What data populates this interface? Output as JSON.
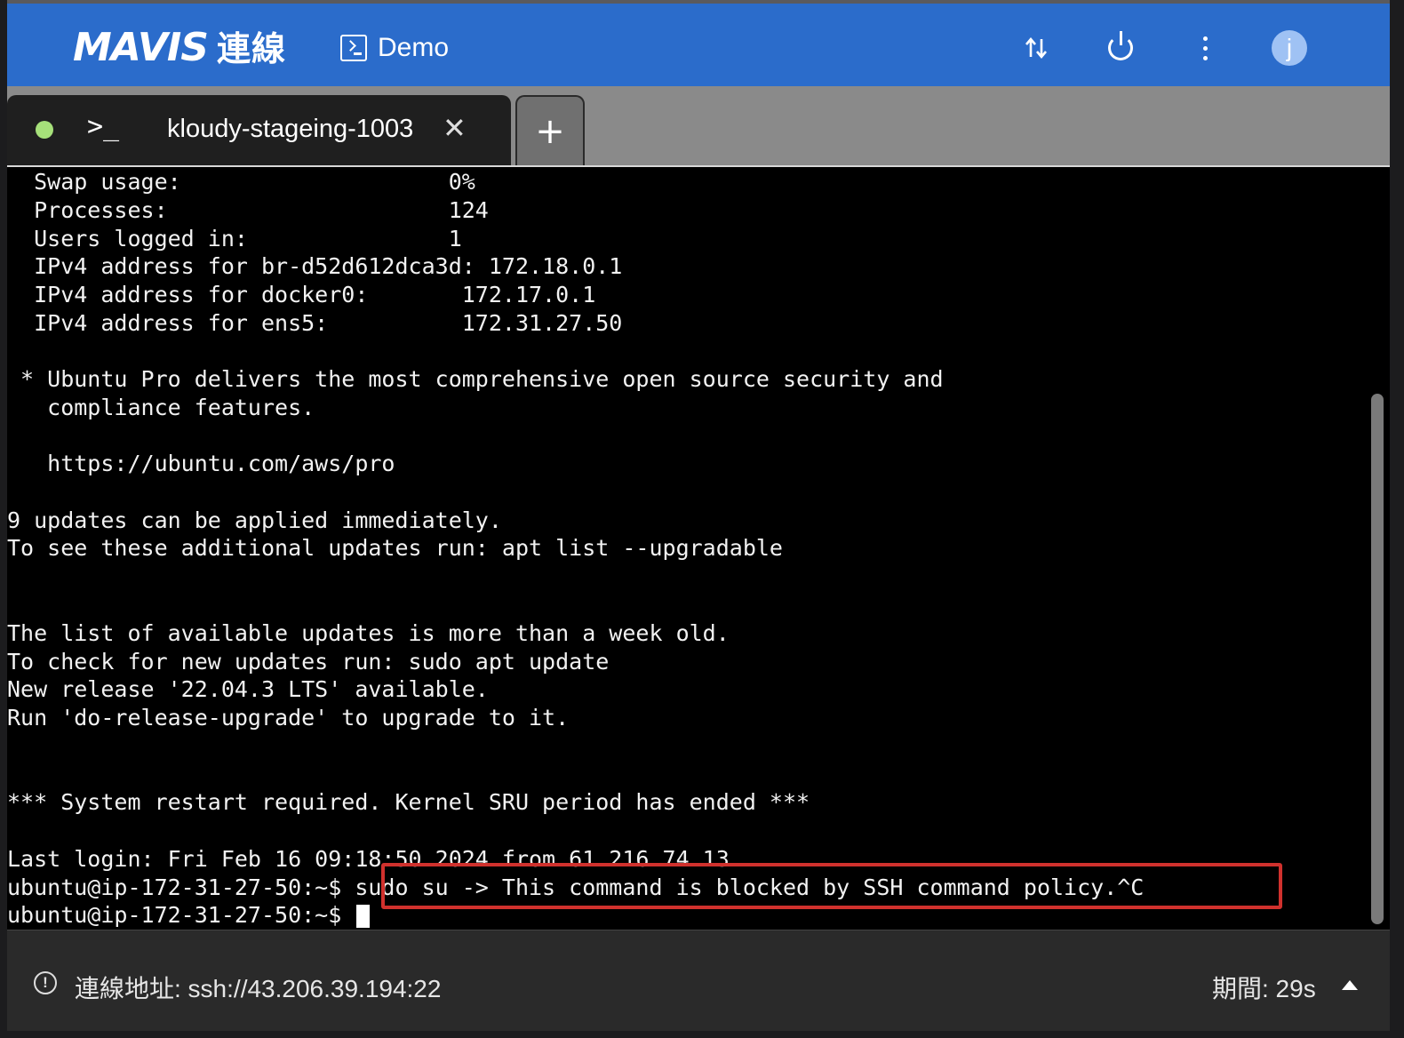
{
  "header": {
    "brand": "MAVIS",
    "brand_sub": "連線",
    "session_label": "Demo",
    "transfer_icon": "sort-arrows-icon",
    "power_icon": "power-icon",
    "menu_icon": "more-vertical-icon",
    "avatar_initial": "j",
    "colors": {
      "bar": "#2b6ccb",
      "avatar": "#9fc2f4"
    }
  },
  "tabs": [
    {
      "label": "kloudy-stageing-1003",
      "status_color": "#a6e07a",
      "prompt_glyph": ">_",
      "close_glyph": "✕"
    }
  ],
  "new_tab_glyph": "+",
  "terminal": {
    "lines": [
      "  Swap usage:                    0%",
      "  Processes:                     124",
      "  Users logged in:               1",
      "  IPv4 address for br-d52d612dca3d: 172.18.0.1",
      "  IPv4 address for docker0:       172.17.0.1",
      "  IPv4 address for ens5:          172.31.27.50",
      "",
      " * Ubuntu Pro delivers the most comprehensive open source security and",
      "   compliance features.",
      "",
      "   https://ubuntu.com/aws/pro",
      "",
      "9 updates can be applied immediately.",
      "To see these additional updates run: apt list --upgradable",
      "",
      "",
      "The list of available updates is more than a week old.",
      "To check for new updates run: sudo apt update",
      "New release '22.04.3 LTS' available.",
      "Run 'do-release-upgrade' to upgrade to it.",
      "",
      "",
      "*** System restart required. Kernel SRU period has ended ***",
      "",
      "Last login: Fri Feb 16 09:18:50 2024 from 61.216.74.13",
      "ubuntu@ip-172-31-27-50:~$ sudo su -> This command is blocked by SSH command policy.^C",
      "ubuntu@ip-172-31-27-50:~$ "
    ],
    "highlight_color": "#d0312d"
  },
  "footer": {
    "address_label": "連線地址: ssh://43.206.39.194:22",
    "duration_label": "期間: 29s",
    "info_icon": "info-circle-icon",
    "expand_icon": "caret-up-icon"
  }
}
